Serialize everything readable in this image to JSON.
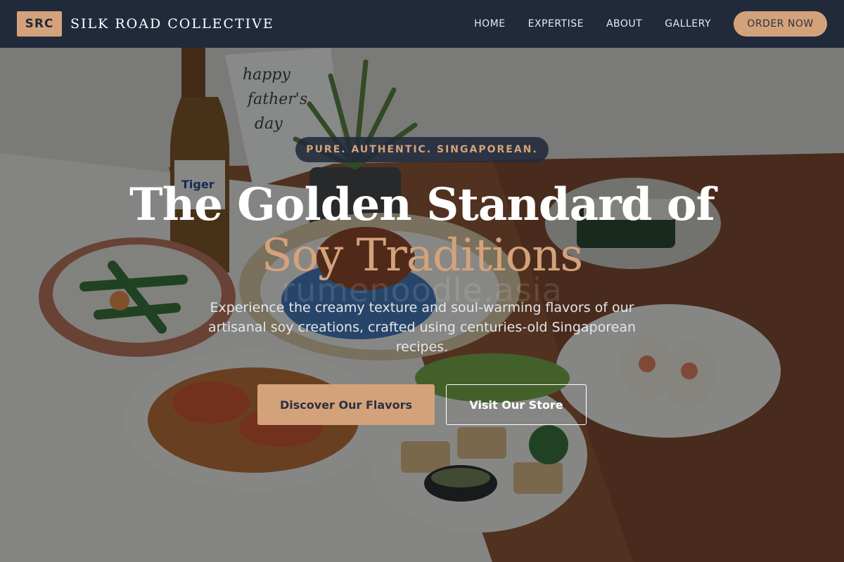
{
  "navbar": {
    "logo_badge": "SRC",
    "brand_name": "SILK ROAD COLLECTIVE",
    "links": [
      {
        "label": "HOME"
      },
      {
        "label": "EXPERTISE"
      },
      {
        "label": "ABOUT"
      },
      {
        "label": "GALLERY"
      }
    ],
    "cta_label": "ORDER NOW"
  },
  "hero": {
    "tagline": "PURE. AUTHENTIC. SINGAPOREAN.",
    "title_line1": "The Golden Standard of",
    "title_line2": "Soy Traditions",
    "watermark": "rumenoodle.asia",
    "subtitle": "Experience the creamy texture and soul-warming flavors of our artisanal soy creations, crafted using centuries-old Singaporean recipes.",
    "primary_button": "Discover Our Flavors",
    "secondary_button": "Visit Our Store",
    "card_text": [
      "happy",
      "father's",
      "day"
    ],
    "bottle_label": "Tiger"
  },
  "colors": {
    "nav_background": "#212a3b",
    "accent_gold": "#d4a27a",
    "text_white": "#ffffff",
    "table_wood": "#8a4a24"
  }
}
